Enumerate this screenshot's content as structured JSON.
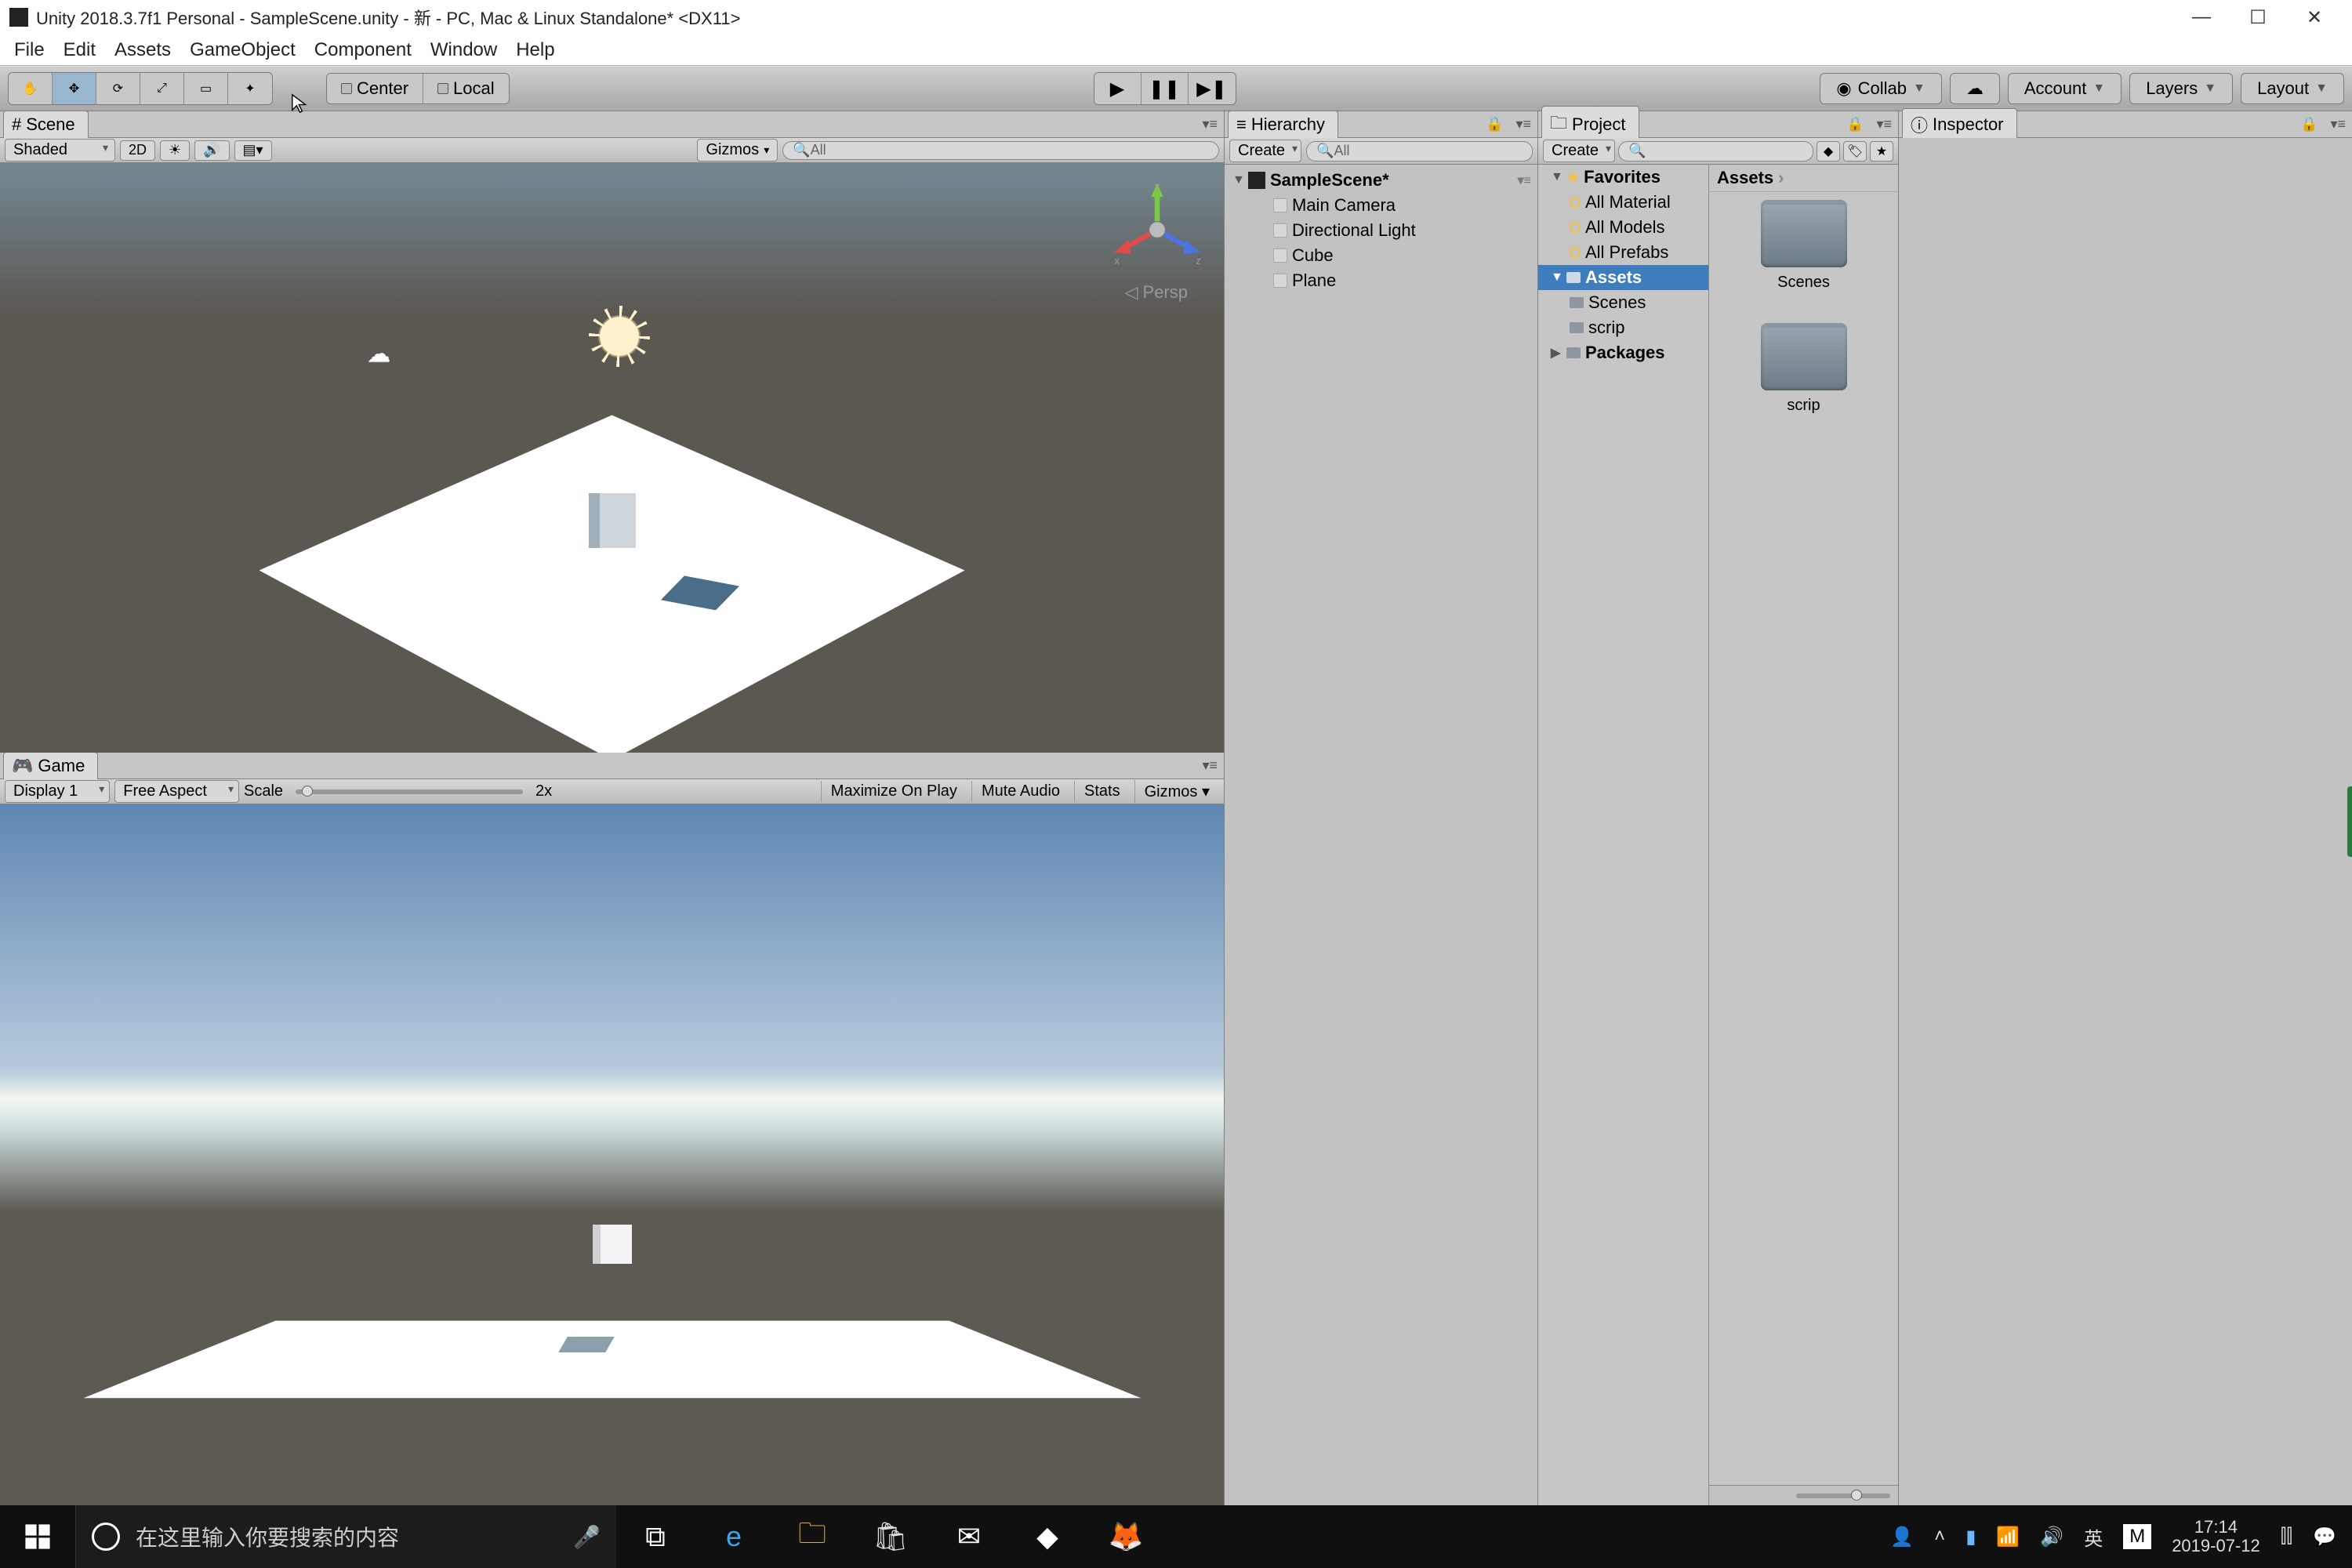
{
  "titlebar": {
    "title": "Unity 2018.3.7f1 Personal - SampleScene.unity - 新 - PC, Mac & Linux Standalone* <DX11>"
  },
  "menubar": [
    "File",
    "Edit",
    "Assets",
    "GameObject",
    "Component",
    "Window",
    "Help"
  ],
  "toolbar": {
    "pivot_center": "Center",
    "pivot_local": "Local",
    "collab": "Collab",
    "account": "Account",
    "layers": "Layers",
    "layout": "Layout"
  },
  "scene_tab": "Scene",
  "scene_ctl": {
    "shaded": "Shaded",
    "two_d": "2D",
    "gizmos": "Gizmos",
    "search_ph": "All",
    "persp": "Persp"
  },
  "game_tab": "Game",
  "game_ctl": {
    "display": "Display 1",
    "aspect": "Free Aspect",
    "scale_lbl": "Scale",
    "scale_val": "2x",
    "maximize": "Maximize On Play",
    "mute": "Mute Audio",
    "stats": "Stats",
    "gizmos": "Gizmos"
  },
  "hierarchy_tab": "Hierarchy",
  "hierarchy": {
    "create": "Create",
    "search_ph": "All",
    "root": "SampleScene*",
    "items": [
      "Main Camera",
      "Directional Light",
      "Cube",
      "Plane"
    ]
  },
  "project_tab": "Project",
  "project": {
    "create": "Create",
    "favorites": "Favorites",
    "fav_items": [
      "All Material",
      "All Models",
      "All Prefabs"
    ],
    "assets": "Assets",
    "asset_children": [
      "Scenes",
      "scrip"
    ],
    "packages": "Packages",
    "breadcrumb": "Assets",
    "grid_items": [
      "Scenes",
      "scrip"
    ]
  },
  "inspector_tab": "Inspector",
  "taskbar": {
    "search_ph": "在这里输入你要搜索的内容",
    "ime1": "英",
    "ime2": "M",
    "time": "17:14",
    "date": "2019-07-12"
  }
}
